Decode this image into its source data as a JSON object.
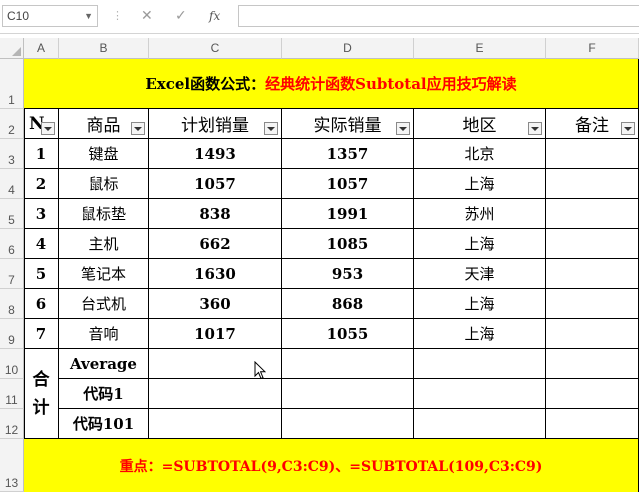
{
  "formula_bar": {
    "name_box": "C10",
    "cancel_icon": "✕",
    "enter_icon": "✓",
    "fx_label": "fx",
    "formula": ""
  },
  "columns": [
    "A",
    "B",
    "C",
    "D",
    "E",
    "F"
  ],
  "rows": [
    "1",
    "2",
    "3",
    "4",
    "5",
    "6",
    "7",
    "8",
    "9",
    "10",
    "11",
    "12",
    "13"
  ],
  "sheet": {
    "title_black": "Excel函数公式：",
    "title_red": "经典统计函数Subtotal应用技巧解读",
    "headers": [
      "N",
      "商品",
      "计划销量",
      "实际销量",
      "地区",
      "备注"
    ],
    "data_rows": [
      [
        "1",
        "键盘",
        "1493",
        "1357",
        "北京",
        ""
      ],
      [
        "2",
        "鼠标",
        "1057",
        "1057",
        "上海",
        ""
      ],
      [
        "3",
        "鼠标垫",
        "838",
        "1991",
        "苏州",
        ""
      ],
      [
        "4",
        "主机",
        "662",
        "1085",
        "上海",
        ""
      ],
      [
        "5",
        "笔记本",
        "1630",
        "953",
        "天津",
        ""
      ],
      [
        "6",
        "台式机",
        "360",
        "868",
        "上海",
        ""
      ],
      [
        "7",
        "音响",
        "1017",
        "1055",
        "上海",
        ""
      ]
    ],
    "total_label": "合\n计",
    "total_rows": [
      "Average",
      "代码1",
      "代码101"
    ],
    "note": "重点：=SUBTOTAL(9,C3:C9)、=SUBTOTAL(109,C3:C9)"
  },
  "colors": {
    "title_bg": "#ffff00",
    "accent_red": "#ff0000"
  }
}
